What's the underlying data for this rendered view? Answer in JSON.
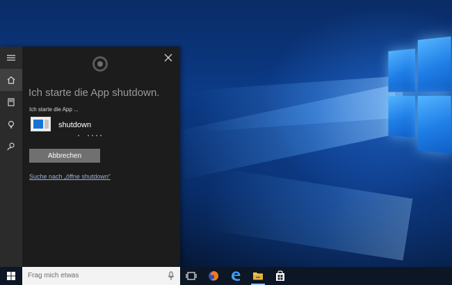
{
  "cortana": {
    "headline": "Ich starte die App shutdown.",
    "subline": "Ich starte die App ...",
    "app_name": "shutdown",
    "cancel_label": "Abbrechen",
    "search_link": "Suche nach „öffne shutdown“"
  },
  "sidebar": {
    "items": [
      {
        "name": "hamburger-menu",
        "icon": "menu-icon"
      },
      {
        "name": "home",
        "icon": "home-icon",
        "active": true
      },
      {
        "name": "notebook",
        "icon": "notebook-icon"
      },
      {
        "name": "tips",
        "icon": "lightbulb-icon"
      },
      {
        "name": "feedback",
        "icon": "feedback-icon"
      }
    ]
  },
  "taskbar": {
    "search_placeholder": "Frag mich etwas",
    "icons": [
      "windows-start-icon",
      "task-view-icon",
      "firefox-icon",
      "edge-icon",
      "file-explorer-icon",
      "store-icon"
    ]
  },
  "colors": {
    "accent": "#1673d6",
    "panel": "#1c1c1c",
    "rail": "#2b2b2b",
    "taskbar": "#0c1624"
  }
}
